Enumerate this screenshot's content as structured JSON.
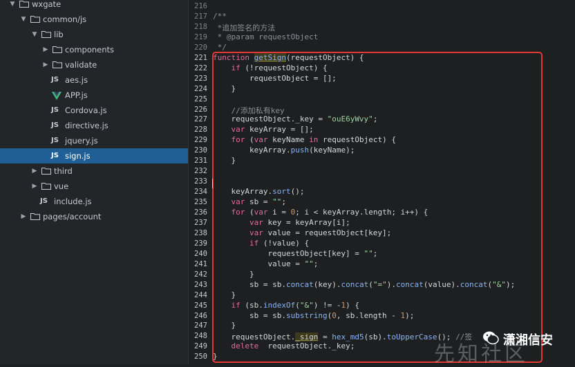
{
  "sidebar": {
    "items": [
      {
        "label": "wxgate",
        "kind": "folder",
        "open": true,
        "depth": 0
      },
      {
        "label": "common/js",
        "kind": "folder",
        "open": true,
        "depth": 1
      },
      {
        "label": "lib",
        "kind": "folder",
        "open": true,
        "depth": 2
      },
      {
        "label": "components",
        "kind": "folder",
        "open": false,
        "depth": 3
      },
      {
        "label": "validate",
        "kind": "folder",
        "open": false,
        "depth": 3
      },
      {
        "label": "aes.js",
        "kind": "js",
        "depth": 3
      },
      {
        "label": "APP.js",
        "kind": "vue",
        "depth": 3
      },
      {
        "label": "Cordova.js",
        "kind": "js",
        "depth": 3
      },
      {
        "label": "directive.js",
        "kind": "js",
        "depth": 3
      },
      {
        "label": "jquery.js",
        "kind": "js",
        "depth": 3
      },
      {
        "label": "sign.js",
        "kind": "js",
        "depth": 3,
        "selected": true
      },
      {
        "label": "third",
        "kind": "folder",
        "open": false,
        "depth": 2
      },
      {
        "label": "vue",
        "kind": "folder",
        "open": false,
        "depth": 2
      },
      {
        "label": "include.js",
        "kind": "js",
        "depth": 2
      },
      {
        "label": "pages/account",
        "kind": "folder",
        "open": false,
        "depth": 1
      }
    ],
    "js_badge": "JS"
  },
  "editor": {
    "lines": [
      {
        "n": "216",
        "t": ""
      },
      {
        "n": "217",
        "t": "/**"
      },
      {
        "n": "218",
        "t": " *追加签名的方法"
      },
      {
        "n": "219",
        "t": " * @param requestObject"
      },
      {
        "n": "220",
        "t": " */"
      },
      {
        "n": "221",
        "t": "function getSign(requestObject) {"
      },
      {
        "n": "222",
        "t": "    if (!requestObject) {"
      },
      {
        "n": "223",
        "t": "        requestObject = [];"
      },
      {
        "n": "224",
        "t": "    }"
      },
      {
        "n": "225",
        "t": ""
      },
      {
        "n": "226",
        "t": "    //添加私有key"
      },
      {
        "n": "227",
        "t": "    requestObject._key = \"ouE6yWvy\";"
      },
      {
        "n": "228",
        "t": "    var keyArray = [];"
      },
      {
        "n": "229",
        "t": "    for (var keyName in requestObject) {"
      },
      {
        "n": "230",
        "t": "        keyArray.push(keyName);"
      },
      {
        "n": "231",
        "t": "    }"
      },
      {
        "n": "232",
        "t": ""
      },
      {
        "n": "233",
        "t": ""
      },
      {
        "n": "234",
        "t": "    keyArray.sort();"
      },
      {
        "n": "235",
        "t": "    var sb = \"\";"
      },
      {
        "n": "236",
        "t": "    for (var i = 0; i < keyArray.length; i++) {"
      },
      {
        "n": "237",
        "t": "        var key = keyArray[i];"
      },
      {
        "n": "238",
        "t": "        var value = requestObject[key];"
      },
      {
        "n": "239",
        "t": "        if (!value) {"
      },
      {
        "n": "240",
        "t": "            requestObject[key] = \"\";"
      },
      {
        "n": "241",
        "t": "            value = \"\";"
      },
      {
        "n": "242",
        "t": "        }"
      },
      {
        "n": "243",
        "t": "        sb = sb.concat(key).concat(\"=\").concat(value).concat(\"&\");"
      },
      {
        "n": "244",
        "t": "    }"
      },
      {
        "n": "245",
        "t": "    if (sb.indexOf(\"&\") != -1) {"
      },
      {
        "n": "246",
        "t": "        sb = sb.substring(0, sb.length - 1);"
      },
      {
        "n": "247",
        "t": "    }"
      },
      {
        "n": "248",
        "t": "    requestObject._sign = hex_md5(sb).toUpperCase(); //签"
      },
      {
        "n": "249",
        "t": "    delete  requestObject._key;"
      },
      {
        "n": "250",
        "t": "}"
      }
    ]
  },
  "watermark": {
    "brand": "潇湘信安",
    "big_text": "先知社区"
  },
  "colors": {
    "accent_red": "#e53935",
    "selection_blue": "#1f5f96",
    "vue_green": "#41b883"
  }
}
